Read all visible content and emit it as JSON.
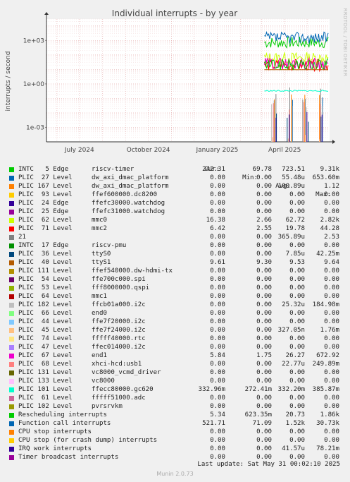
{
  "chart_data": {
    "type": "line",
    "title": "Individual interrupts - by year",
    "ylabel": "interrupts / second",
    "yscale": "log",
    "ylim": [
      0.0001,
      30000
    ],
    "yticks": [
      {
        "label": "1e+03",
        "value": 1000
      },
      {
        "label": "1e+00",
        "value": 1
      },
      {
        "label": "1e-03",
        "value": 0.001
      }
    ],
    "xticks": [
      "July 2024",
      "October 2024",
      "January 2025",
      "April 2025"
    ],
    "x_start": "2024-05-18",
    "x_end": "2025-05-31",
    "data_start": "2025-03-05",
    "grid": true,
    "columns": [
      "Cur:",
      "Min:",
      "Avg:",
      "Max:"
    ],
    "series": [
      {
        "name": "INTC   5 Edge      riscv-timer",
        "color": "#00cc00",
        "cur": "242.31",
        "min": "69.78",
        "avg": "723.51",
        "max": "9.31k"
      },
      {
        "name": "PLIC  27 Level     dw_axi_dmac_platform",
        "color": "#0066b3",
        "cur": "0.00",
        "min": "0.00",
        "avg": "55.48u",
        "max": "653.60m"
      },
      {
        "name": "PLIC 167 Level     dw_axi_dmac_platform",
        "color": "#ff8000",
        "cur": "0.00",
        "min": "0.00",
        "avg": "100.89u",
        "max": "1.12"
      },
      {
        "name": "PLIC  93 Level     ffef600000.dc8200",
        "color": "#ffcc00",
        "cur": "0.00",
        "min": "0.00",
        "avg": "0.00",
        "max": "0.00"
      },
      {
        "name": "PLIC  24 Edge      ffefc30000.watchdog",
        "color": "#330099",
        "cur": "0.00",
        "min": "0.00",
        "avg": "0.00",
        "max": "0.00"
      },
      {
        "name": "PLIC  25 Edge      ffefc31000.watchdog",
        "color": "#990099",
        "cur": "0.00",
        "min": "0.00",
        "avg": "0.00",
        "max": "0.00"
      },
      {
        "name": "PLIC  62 Level     mmc0",
        "color": "#ccff00",
        "cur": "16.38",
        "min": "2.66",
        "avg": "62.72",
        "max": "2.82k"
      },
      {
        "name": "PLIC  71 Level     mmc2",
        "color": "#ff0000",
        "cur": "6.42",
        "min": "2.55",
        "avg": "19.78",
        "max": "44.28"
      },
      {
        "name": "21",
        "color": "#808080",
        "cur": "0.00",
        "min": "0.00",
        "avg": "365.89u",
        "max": "2.53"
      },
      {
        "name": "INTC  17 Edge      riscv-pmu",
        "color": "#008f00",
        "cur": "0.00",
        "min": "0.00",
        "avg": "0.00",
        "max": "0.00"
      },
      {
        "name": "PLIC  36 Level     ttyS0",
        "color": "#00487d",
        "cur": "0.00",
        "min": "0.00",
        "avg": "7.85u",
        "max": "42.25m"
      },
      {
        "name": "PLIC  40 Level     ttyS1",
        "color": "#b35a00",
        "cur": "9.61",
        "min": "9.30",
        "avg": "9.53",
        "max": "9.64"
      },
      {
        "name": "PLIC 111 Level     ffef540000.dw-hdmi-tx",
        "color": "#b38f00",
        "cur": "0.00",
        "min": "0.00",
        "avg": "0.00",
        "max": "0.00"
      },
      {
        "name": "PLIC  54 Level     ffe700c000.spi",
        "color": "#6b006b",
        "cur": "0.00",
        "min": "0.00",
        "avg": "0.00",
        "max": "0.00"
      },
      {
        "name": "PLIC  53 Level     fff8000000.qspi",
        "color": "#8fb300",
        "cur": "0.00",
        "min": "0.00",
        "avg": "0.00",
        "max": "0.00"
      },
      {
        "name": "PLIC  64 Level     mmc1",
        "color": "#b30000",
        "cur": "0.00",
        "min": "0.00",
        "avg": "0.00",
        "max": "0.00"
      },
      {
        "name": "PLIC 182 Level     ffcb01a000.i2c",
        "color": "#bebebe",
        "cur": "0.00",
        "min": "0.00",
        "avg": "25.32u",
        "max": "184.98m"
      },
      {
        "name": "PLIC  66 Level     end0",
        "color": "#80ff80",
        "cur": "0.00",
        "min": "0.00",
        "avg": "0.00",
        "max": "0.00"
      },
      {
        "name": "PLIC  44 Level     ffe7f20000.i2c",
        "color": "#80c9ff",
        "cur": "0.00",
        "min": "0.00",
        "avg": "0.00",
        "max": "0.00"
      },
      {
        "name": "PLIC  45 Level     ffe7f24000.i2c",
        "color": "#ffc080",
        "cur": "0.00",
        "min": "0.00",
        "avg": "327.05n",
        "max": "1.76m"
      },
      {
        "name": "PLIC  74 Level     fffff40000.rtc",
        "color": "#ffe680",
        "cur": "0.00",
        "min": "0.00",
        "avg": "0.00",
        "max": "0.00"
      },
      {
        "name": "PLIC  47 Level     ffec014000.i2c",
        "color": "#aa80ff",
        "cur": "0.00",
        "min": "0.00",
        "avg": "0.00",
        "max": "0.00"
      },
      {
        "name": "PLIC  67 Level     end1",
        "color": "#ee00cc",
        "cur": "5.84",
        "min": "1.75",
        "avg": "26.27",
        "max": "672.92"
      },
      {
        "name": "PLIC  68 Level     xhci-hcd:usb1",
        "color": "#ff8080",
        "cur": "0.00",
        "min": "0.00",
        "avg": "22.77u",
        "max": "249.89m"
      },
      {
        "name": "PLIC 131 Level     vc8000_vcmd_driver",
        "color": "#666600",
        "cur": "0.00",
        "min": "0.00",
        "avg": "0.00",
        "max": "0.00"
      },
      {
        "name": "PLIC 133 Level     vc8000",
        "color": "#ffbfff",
        "cur": "0.00",
        "min": "0.00",
        "avg": "0.00",
        "max": "0.00"
      },
      {
        "name": "PLIC 101 Level     ffecc80000.gc620",
        "color": "#00ffcc",
        "cur": "332.96m",
        "min": "272.41m",
        "avg": "332.20m",
        "max": "385.87m"
      },
      {
        "name": "PLIC  61 Level     fffff51000.adc",
        "color": "#cc6699",
        "cur": "0.00",
        "min": "0.00",
        "avg": "0.00",
        "max": "0.00"
      },
      {
        "name": "PLIC 102 Level     pvrsrvkm",
        "color": "#999900",
        "cur": "0.00",
        "min": "0.00",
        "avg": "0.00",
        "max": "0.00"
      },
      {
        "name": "Rescheduling interrupts",
        "color": "#00cc00",
        "cur": "5.34",
        "min": "623.35m",
        "avg": "20.73",
        "max": "1.86k"
      },
      {
        "name": "Function call interrupts",
        "color": "#0066b3",
        "cur": "521.71",
        "min": "71.09",
        "avg": "1.52k",
        "max": "30.73k"
      },
      {
        "name": "CPU stop interrupts",
        "color": "#ff8000",
        "cur": "0.00",
        "min": "0.00",
        "avg": "0.00",
        "max": "0.00"
      },
      {
        "name": "CPU stop (for crash dump) interrupts",
        "color": "#ffcc00",
        "cur": "0.00",
        "min": "0.00",
        "avg": "0.00",
        "max": "0.00"
      },
      {
        "name": "IRQ work interrupts",
        "color": "#330099",
        "cur": "0.00",
        "min": "0.00",
        "avg": "41.57u",
        "max": "78.21m"
      },
      {
        "name": "Timer broadcast interrupts",
        "color": "#990099",
        "cur": "0.00",
        "min": "0.00",
        "avg": "0.00",
        "max": "0.00"
      }
    ]
  },
  "side_label": "RRDTOOL / TOBI OETIKER",
  "last_update": "Last update: Sat May 31 00:02:10 2025",
  "footer": "Munin 2.0.73"
}
